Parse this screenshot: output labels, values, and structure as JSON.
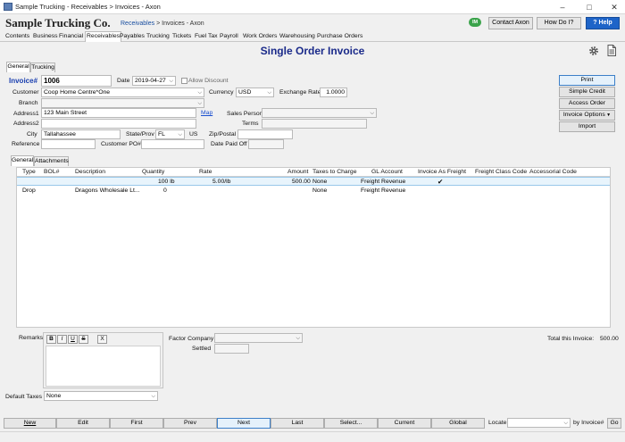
{
  "window": {
    "title": "Sample Trucking - Receivables > Invoices - Axon",
    "minimize": "–",
    "maximize": "□",
    "close": "✕"
  },
  "header": {
    "company": "Sample Trucking Co.",
    "breadcrumb": {
      "part1": "Receivables",
      "sep1": " > ",
      "part2": "Invoices",
      "sep2": " - ",
      "part3": "Axon"
    },
    "im_badge": "IM",
    "contact_label": "Contact Axon",
    "howdoi_label": "How Do I?",
    "help_label": "? Help"
  },
  "menu": [
    "Contents",
    "Business",
    "Financial",
    "Receivables",
    "Payables",
    "Trucking",
    "Tickets",
    "Fuel Tax",
    "Payroll",
    "Work Orders",
    "Warehousing",
    "Purchase Orders"
  ],
  "page_title": "Single Order Invoice",
  "top_tabs": [
    "General",
    "Trucking"
  ],
  "form": {
    "invoice_label": "Invoice#",
    "invoice_value": "1006",
    "date_label": "Date",
    "date_value": "2019-04-27",
    "allow_discount_label": "Allow Discount",
    "customer_label": "Customer",
    "customer_value": "Coop Home Centre*One",
    "currency_label": "Currency",
    "currency_value": "USD",
    "exchange_label": "Exchange Rate",
    "exchange_value": "1.0000",
    "branch_label": "Branch",
    "branch_value": "",
    "address1_label": "Address1",
    "address1_value": "123 Main Street",
    "map_label": "Map",
    "salesperson_label": "Sales Person",
    "salesperson_value": "",
    "address2_label": "Address2",
    "address2_value": "",
    "terms_label": "Terms",
    "terms_value": "",
    "city_label": "City",
    "city_value": "Tallahassee",
    "state_label": "State/Prov",
    "state_value": "FL",
    "country_value": "US",
    "zip_label": "Zip/Postal",
    "zip_value": "",
    "reference_label": "Reference",
    "reference_value": "",
    "customer_po_label": "Customer PO#",
    "customer_po_value": "",
    "date_paid_label": "Date Paid Off",
    "date_paid_value": ""
  },
  "side_buttons": [
    "Print",
    "Simple Credit",
    "Access Order",
    "Invoice Options",
    "Import"
  ],
  "inner_tabs": [
    "General",
    "Attachments"
  ],
  "grid": {
    "headers": [
      "Type",
      "BOL#",
      "Description",
      "Quantity",
      "Rate",
      "Amount",
      "Taxes to Charge",
      "GL Account",
      "Invoice As Freight",
      "Freight Class Code",
      "Accessorial Code"
    ],
    "rows": [
      {
        "type": "",
        "bol": "",
        "description": "",
        "quantity": "100 lb",
        "rate": "5.00/lb",
        "amount": "500.00",
        "taxes": "None",
        "gl": "Freight Revenue",
        "freight": "✔",
        "fcc": "",
        "acc": ""
      },
      {
        "type": "Drop",
        "bol": "",
        "description": "Dragons Wholesale Lt...",
        "quantity": "0",
        "rate": "",
        "amount": "",
        "taxes": "None",
        "gl": "Freight Revenue",
        "freight": "",
        "fcc": "",
        "acc": ""
      }
    ]
  },
  "bottom": {
    "remarks_label": "Remarks",
    "fmt": [
      "B",
      "I",
      "U",
      "S",
      "X"
    ],
    "factor_label": "Factor Company",
    "factor_value": "",
    "settled_label": "Settled",
    "settled_value": "",
    "total_label": "Total this Invoice:",
    "total_value": "500.00",
    "default_taxes_label": "Default Taxes",
    "default_taxes_value": "None"
  },
  "nav": {
    "new": "New",
    "edit": "Edit",
    "first": "First",
    "prev": "Prev",
    "next": "Next",
    "last": "Last",
    "select": "Select...",
    "current": "Current",
    "global": "Global",
    "locate_label": "Locate",
    "locate_value": "",
    "by_invoice": "by Invoice#",
    "go": "Go"
  }
}
